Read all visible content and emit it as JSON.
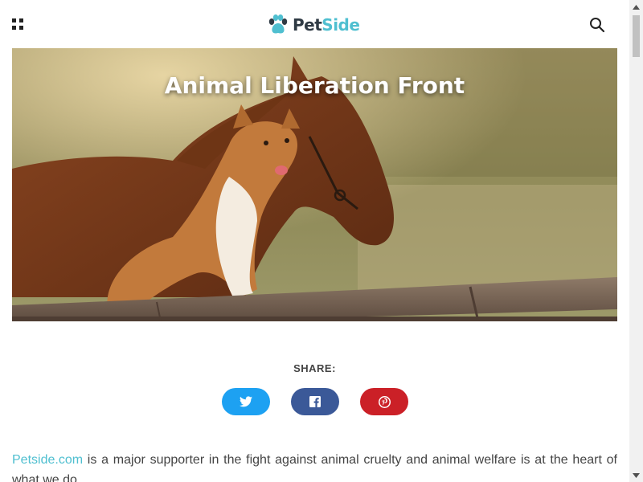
{
  "header": {
    "logo_part1": "Pet",
    "logo_part2": "Side",
    "menu_icon": "grid-menu-icon",
    "search_icon": "search-icon"
  },
  "hero": {
    "title": "Animal Liberation Front",
    "image": "photo of a dog and horse behind a wooden fence"
  },
  "share": {
    "label": "SHARE:",
    "buttons": [
      {
        "name": "twitter",
        "icon": "twitter-icon",
        "color": "#1da1f2"
      },
      {
        "name": "facebook",
        "icon": "facebook-icon",
        "color": "#3b5998"
      },
      {
        "name": "pinterest",
        "icon": "pinterest-icon",
        "color": "#cb2027"
      }
    ]
  },
  "article": {
    "link_text": "Petside.com",
    "intro_rest": " is a major supporter in the fight against animal cruelty and animal welfare is at the heart of what we do."
  },
  "colors": {
    "brand_teal": "#4fbfd0",
    "brand_dark": "#2f3a44"
  }
}
